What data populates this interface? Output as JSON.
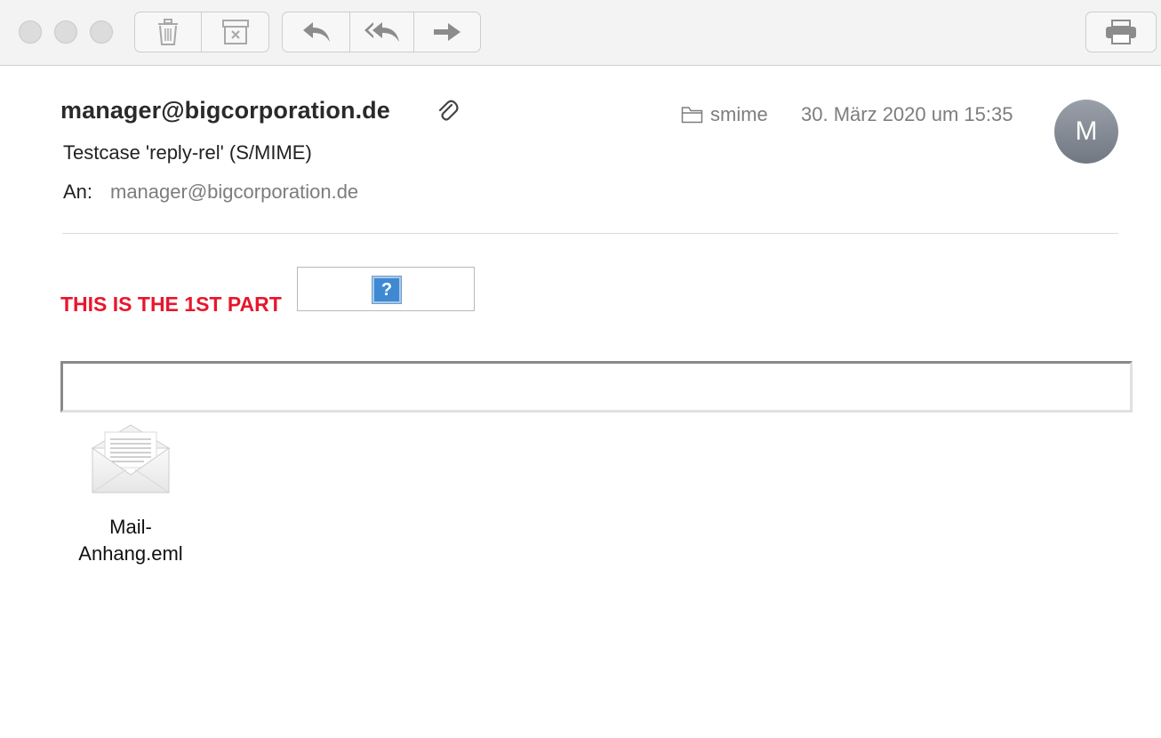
{
  "toolbar": {
    "delete_icon": "trash-icon",
    "junk_icon": "junk-icon",
    "reply_icon": "reply-icon",
    "reply_all_icon": "reply-all-icon",
    "forward_icon": "forward-icon",
    "print_icon": "printer-icon"
  },
  "header": {
    "sender": "manager@bigcorporation.de",
    "folder": "smime",
    "date": "30. März 2020 um 15:35",
    "avatar_initial": "M",
    "subject": "Testcase 'reply-rel' (S/MIME)",
    "to_label": "An:",
    "to_value": "manager@bigcorporation.de"
  },
  "body": {
    "part1_text": "THIS IS THE 1ST PART",
    "missing_image_glyph": "?",
    "attachment_name_line1": "Mail-",
    "attachment_name_line2": "Anhang.eml"
  },
  "colors": {
    "part1_text": "#e8162c",
    "muted_text": "#7d7d7d",
    "toolbar_bg": "#f3f3f3"
  }
}
